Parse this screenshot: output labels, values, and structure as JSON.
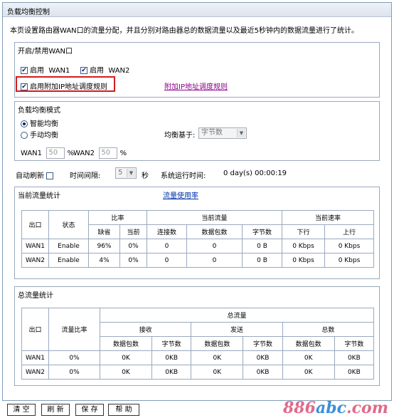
{
  "title": "负载均衡控制",
  "description": "本页设置路由器WAN口的流量分配，并且分别对路由器总的数据流量以及最近5秒钟内的数据流量进行了统计。",
  "wan_toggle": {
    "section_title": "开启/禁用WAN口",
    "enable_label": "启用",
    "wan1": "WAN1",
    "wan2": "WAN2",
    "extra_rule_label": "启用附加IP地址调度规则",
    "extra_rule_link": "附加IP地址调度规则"
  },
  "mode": {
    "section_title": "负载均衡模式",
    "smart": "智能均衡",
    "manual": "手动均衡",
    "basis_label": "均衡基于:",
    "basis_value": "字节数",
    "wan1_label": "WAN1",
    "wan1_value": "50",
    "wan2_label": "WAN2",
    "wan2_value": "50",
    "percent": "%"
  },
  "refresh": {
    "auto_label": "自动刷新",
    "interval_label": "时间间隔:",
    "interval_value": "5",
    "seconds": "秒",
    "runtime_label": "系统运行时间:",
    "runtime_value": "0 day(s) 00:00:19"
  },
  "current": {
    "section_title": "当前流量统计",
    "link": "流量使用率",
    "headers": {
      "port": "出口",
      "status": "状态",
      "ratio": "比率",
      "default": "缺省",
      "current": "当前",
      "current_traffic": "当前流量",
      "connections": "连接数",
      "packets": "数据包数",
      "bytes": "字节数",
      "rate": "当前速率",
      "down": "下行",
      "up": "上行"
    },
    "rows": [
      {
        "port": "WAN1",
        "status": "Enable",
        "default": "96%",
        "current": "0%",
        "connections": "0",
        "packets": "0",
        "bytes": "0 B",
        "down": "0 Kbps",
        "up": "0 Kbps"
      },
      {
        "port": "WAN2",
        "status": "Enable",
        "default": "4%",
        "current": "0%",
        "connections": "0",
        "packets": "0",
        "bytes": "0 B",
        "down": "0 Kbps",
        "up": "0 Kbps"
      }
    ]
  },
  "total": {
    "section_title": "总流量统计",
    "headers": {
      "port": "出口",
      "ratio": "流量比率",
      "total": "总流量",
      "receive": "接收",
      "send": "发送",
      "sum": "总数",
      "packets": "数据包数",
      "bytes": "字节数"
    },
    "rows": [
      {
        "port": "WAN1",
        "ratio": "0%",
        "rx_packets": "0K",
        "rx_bytes": "0KB",
        "tx_packets": "0K",
        "tx_bytes": "0KB",
        "sum_packets": "0K",
        "sum_bytes": "0KB"
      },
      {
        "port": "WAN2",
        "ratio": "0%",
        "rx_packets": "0K",
        "rx_bytes": "0KB",
        "tx_packets": "0K",
        "tx_bytes": "0KB",
        "sum_packets": "0K",
        "sum_bytes": "0KB"
      }
    ]
  },
  "buttons": {
    "clear": "清 空",
    "refresh": "刷 新",
    "save": "保 存",
    "help": "帮 助"
  },
  "watermark": {
    "a": "886",
    "b": "abc",
    ".com": ".com"
  }
}
